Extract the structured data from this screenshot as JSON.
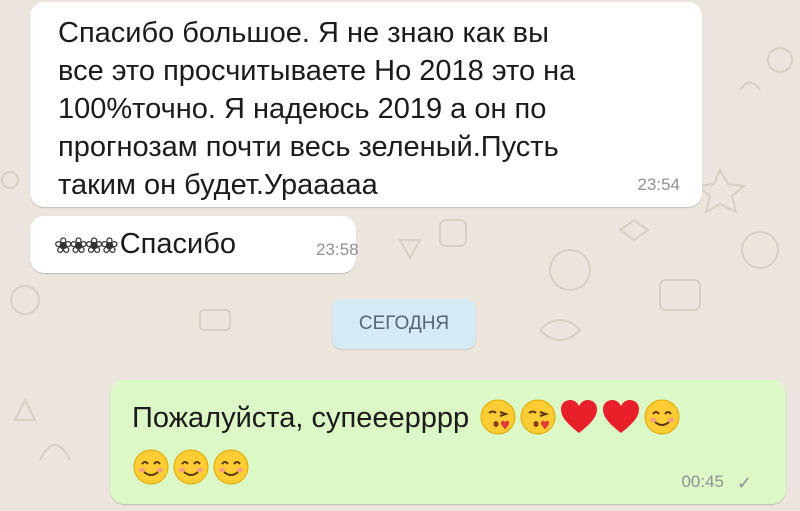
{
  "messages": [
    {
      "direction": "incoming",
      "text": "Спасибо большое. Я не знаю как вы\nвсе это просчитываете Но 2018 это на\n100%точно. Я надеюсь 2019 а он по\nпрогнозам почти весь зеленый.Пусть\nтаким он будет.Урааааа",
      "time": "23:54"
    },
    {
      "direction": "incoming",
      "prefix_emoji": "❀❀❀❀",
      "text": "Спасибо",
      "time": "23:58"
    },
    {
      "direction": "outgoing",
      "text": "Пожалуйста, супееерррр",
      "emojis": [
        "kissing-face-with-heart",
        "kissing-face-with-heart",
        "red-heart",
        "red-heart",
        "smiling-face",
        "smiling-face",
        "smiling-face",
        "smiling-face"
      ],
      "time": "00:45",
      "status": "✓"
    }
  ],
  "date_divider": "СЕГОДНЯ",
  "colors": {
    "wallpaper": "#ece5dd",
    "incoming_bubble": "#ffffff",
    "outgoing_bubble": "#dcf8c6",
    "date_chip": "#d4eaf4",
    "timestamp": "#8e9296"
  }
}
